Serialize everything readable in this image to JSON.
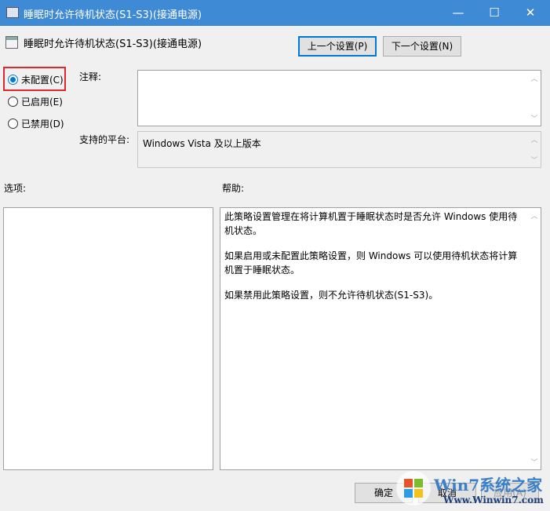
{
  "window": {
    "title": "睡眠时允许待机状态(S1-S3)(接通电源)",
    "minimize": "—",
    "maximize": "☐",
    "close": "✕"
  },
  "header": {
    "policy_name": "睡眠时允许待机状态(S1-S3)(接通电源)",
    "prev_button": "上一个设置(P)",
    "next_button": "下一个设置(N)"
  },
  "state": {
    "options": [
      {
        "label": "未配置(C)",
        "selected": true
      },
      {
        "label": "已启用(E)",
        "selected": false
      },
      {
        "label": "已禁用(D)",
        "selected": false
      }
    ]
  },
  "comment": {
    "label": "注释:",
    "value": ""
  },
  "platform": {
    "label": "支持的平台:",
    "value": "Windows Vista 及以上版本"
  },
  "options_label": "选项:",
  "help": {
    "label": "帮助:",
    "paragraphs": [
      "此策略设置管理在将计算机置于睡眠状态时是否允许 Windows 使用待机状态。",
      "如果启用或未配置此策略设置，则 Windows 可以使用待机状态将计算机置于睡眠状态。",
      "如果禁用此策略设置，则不允许待机状态(S1-S3)。"
    ]
  },
  "footer": {
    "ok": "确定",
    "cancel": "取消",
    "apply": "应用(A)"
  },
  "watermark": {
    "brand": "Win7系统之家",
    "url": "Www.Winwin7.com"
  },
  "colors": {
    "accent": "#0078d7",
    "titlebar": "#3f8ad5",
    "highlight": "#e0282e"
  }
}
